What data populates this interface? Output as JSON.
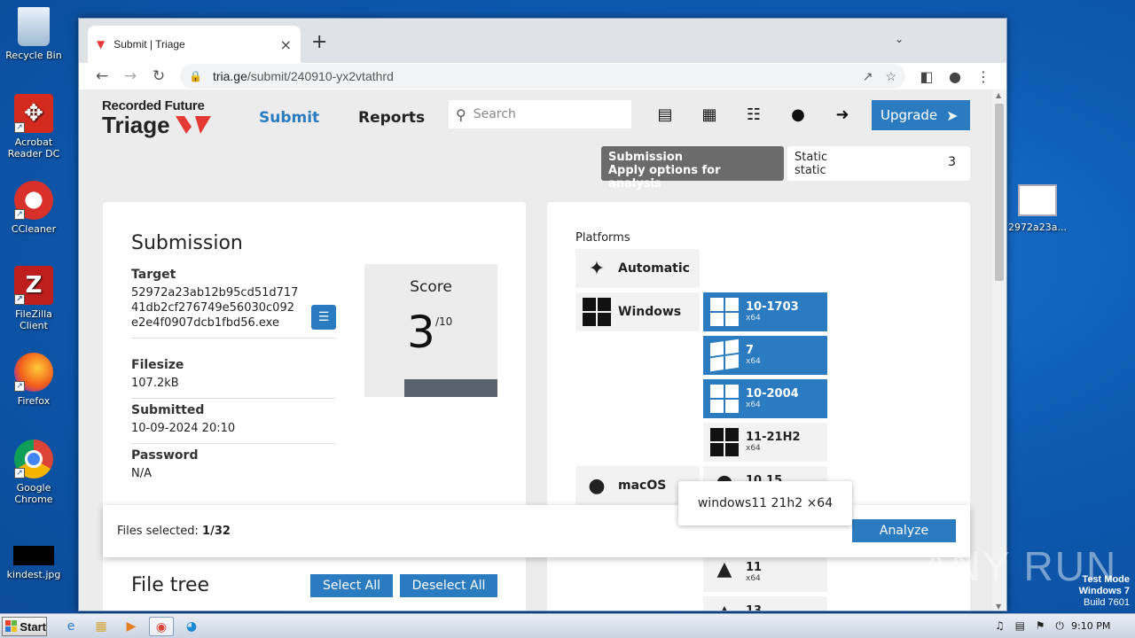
{
  "desktop": {
    "icons": [
      {
        "label": "Recycle Bin"
      },
      {
        "label": "Acrobat Reader DC"
      },
      {
        "label": "CCleaner"
      },
      {
        "label": "FileZilla Client"
      },
      {
        "label": "Firefox"
      },
      {
        "label": "Google Chrome"
      },
      {
        "label": "kindest.jpg"
      }
    ],
    "right_icon_label": "2972a23a...",
    "watermark": "ANY RUN",
    "testmode": {
      "line1": "Test Mode",
      "line2": "Windows 7",
      "line3": "Build 7601"
    }
  },
  "browser": {
    "tab_title": "Submit | Triage",
    "url_host": "tria.ge",
    "url_path": "/submit/240910-yx2vtathrd"
  },
  "header": {
    "logo_line1": "Recorded Future",
    "logo_line2": "Triage",
    "nav_submit": "Submit",
    "nav_reports": "Reports",
    "search_placeholder": "Search",
    "upgrade": "Upgrade"
  },
  "options": {
    "title": "Submission",
    "subtitle": "Apply options for analysis",
    "static_label": "Static",
    "static_sub": "static",
    "static_count": "3"
  },
  "submission": {
    "title": "Submission",
    "target_label": "Target",
    "target_value": "52972a23ab12b95cd51d71741db2cf276749e56030c092e2e4f0907dcb1fbd56.exe",
    "filesize_label": "Filesize",
    "filesize_value": "107.2kB",
    "submitted_label": "Submitted",
    "submitted_value": "10-09-2024 20:10",
    "password_label": "Password",
    "password_value": "N/A",
    "score_label": "Score",
    "score_value": "3",
    "score_max": "/10"
  },
  "platforms": {
    "label": "Platforms",
    "automatic": "Automatic",
    "windows": "Windows",
    "macos": "macOS",
    "windows_versions": [
      {
        "name": "10-1703",
        "arch": "x64"
      },
      {
        "name": "7",
        "arch": "x64"
      },
      {
        "name": "10-2004",
        "arch": "x64"
      },
      {
        "name": "11-21H2",
        "arch": "x64"
      }
    ],
    "macos_version": {
      "name": "10.15",
      "arch": "x64"
    },
    "android_versions": [
      {
        "name": "11",
        "arch": "x64"
      },
      {
        "name": "13",
        "arch": "x64"
      }
    ]
  },
  "filetree": {
    "title": "File tree",
    "select_all": "Select All",
    "deselect_all": "Deselect All"
  },
  "bottom": {
    "files_label": "Files selected: ",
    "files_value": "1/32",
    "analyze": "Analyze"
  },
  "tooltip": "windows11 21h2 ×64",
  "taskbar": {
    "start": "Start",
    "time": "9:10 PM"
  }
}
